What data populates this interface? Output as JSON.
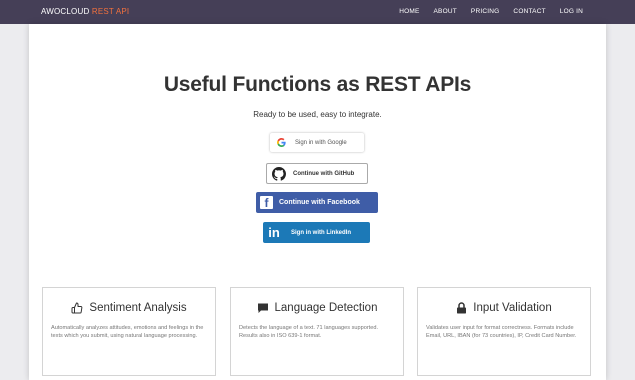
{
  "navbar": {
    "brand_main": "AWOCLOUD",
    "brand_accent": "REST API",
    "items": [
      "HOME",
      "ABOUT",
      "PRICING",
      "CONTACT",
      "LOG IN"
    ]
  },
  "hero": {
    "title": "Useful Functions as REST APIs",
    "subtitle": "Ready to be used, easy to integrate."
  },
  "auth_buttons": {
    "google": "Sign in with Google",
    "github": "Continue with GitHub",
    "facebook": "Continue with Facebook",
    "linkedin": "Sign in with LinkedIn"
  },
  "features": [
    {
      "title": "Sentiment Analysis",
      "icon": "thumbs-up-icon",
      "description": "Automatically analyzes attitudes, emotions and feelings in the texts which you submit, using natural language processing."
    },
    {
      "title": "Language Detection",
      "icon": "comment-icon",
      "description": "Detects the language of a text. 71 languages supported. Results also in ISO 639-1 format."
    },
    {
      "title": "Input Validation",
      "icon": "lock-icon",
      "description": "Validates user input for format correctness. Formats include Email, URL, IBAN (for 73 countries), IP, Credit Card Number."
    }
  ],
  "colors": {
    "navbar": "#453f57",
    "brand_accent": "#f0703e",
    "facebook": "#3f5da7",
    "linkedin": "#1c79b7"
  }
}
